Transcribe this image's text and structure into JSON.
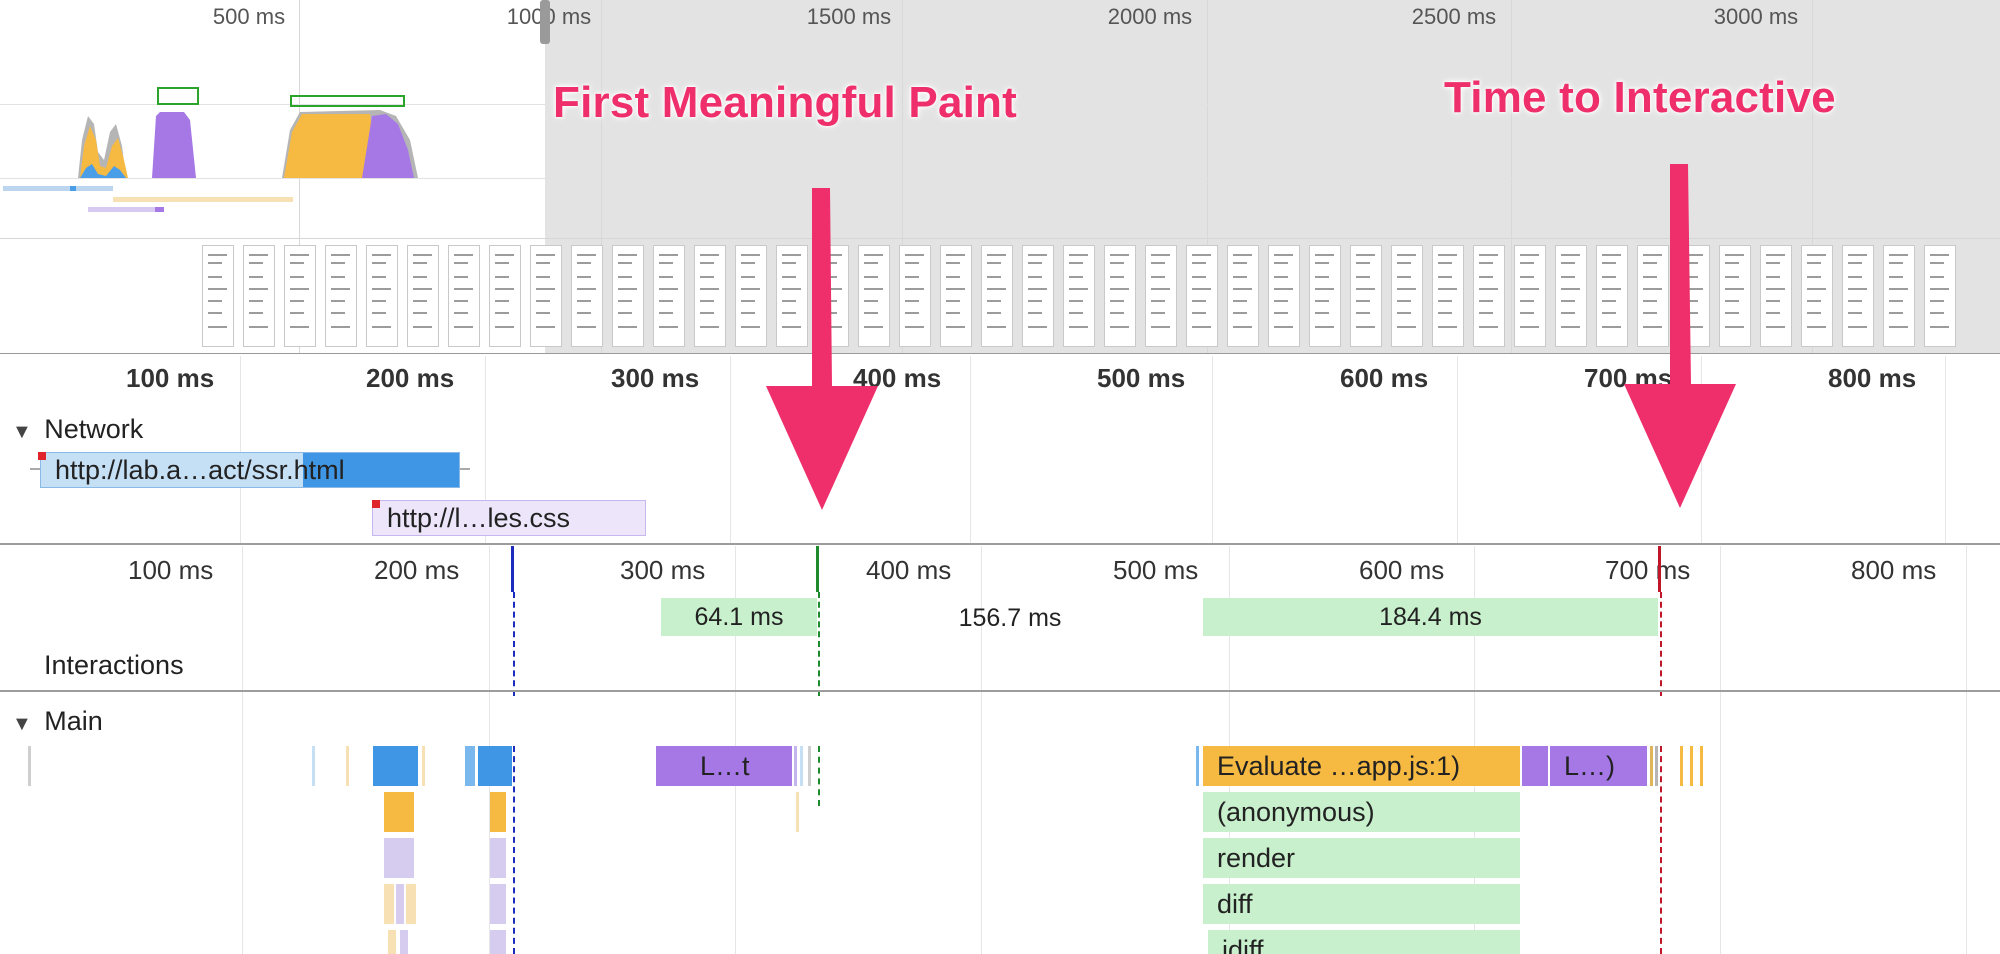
{
  "overview": {
    "ticks": [
      "500 ms",
      "1000 ms",
      "1500 ms",
      "2000 ms",
      "2500 ms",
      "3000 ms"
    ]
  },
  "ruler": {
    "ticks": [
      "100 ms",
      "200 ms",
      "300 ms",
      "400 ms",
      "500 ms",
      "600 ms",
      "700 ms",
      "800 ms"
    ]
  },
  "annotations": {
    "first_meaningful_paint": "First Meaningful Paint",
    "time_to_interactive": "Time to Interactive"
  },
  "network": {
    "title": "Network",
    "requests": [
      {
        "label": "http://lab.a…act/ssr.html"
      },
      {
        "label": "http://l…les.css"
      }
    ]
  },
  "interactions": {
    "title": "Interactions",
    "durations": [
      "64.1 ms",
      "156.7 ms",
      "184.4 ms"
    ]
  },
  "main": {
    "title": "Main",
    "tasks": {
      "layout": "L…t",
      "evaluate": "Evaluate …app.js:1)",
      "layout2": "L…)",
      "anonymous": "(anonymous)",
      "render": "render",
      "diff": "diff",
      "idiff": "idiff"
    }
  },
  "colors": {
    "scripting": "#f6ba42",
    "rendering": "#a678e6",
    "loading": "#4a9ee8",
    "idle_green": "#c8f0cc",
    "annotation": "#ee2f6c",
    "fmp_marker": "#1e8a2e",
    "tti_marker": "#c0162a",
    "dcl_marker": "#1b2cbf"
  }
}
